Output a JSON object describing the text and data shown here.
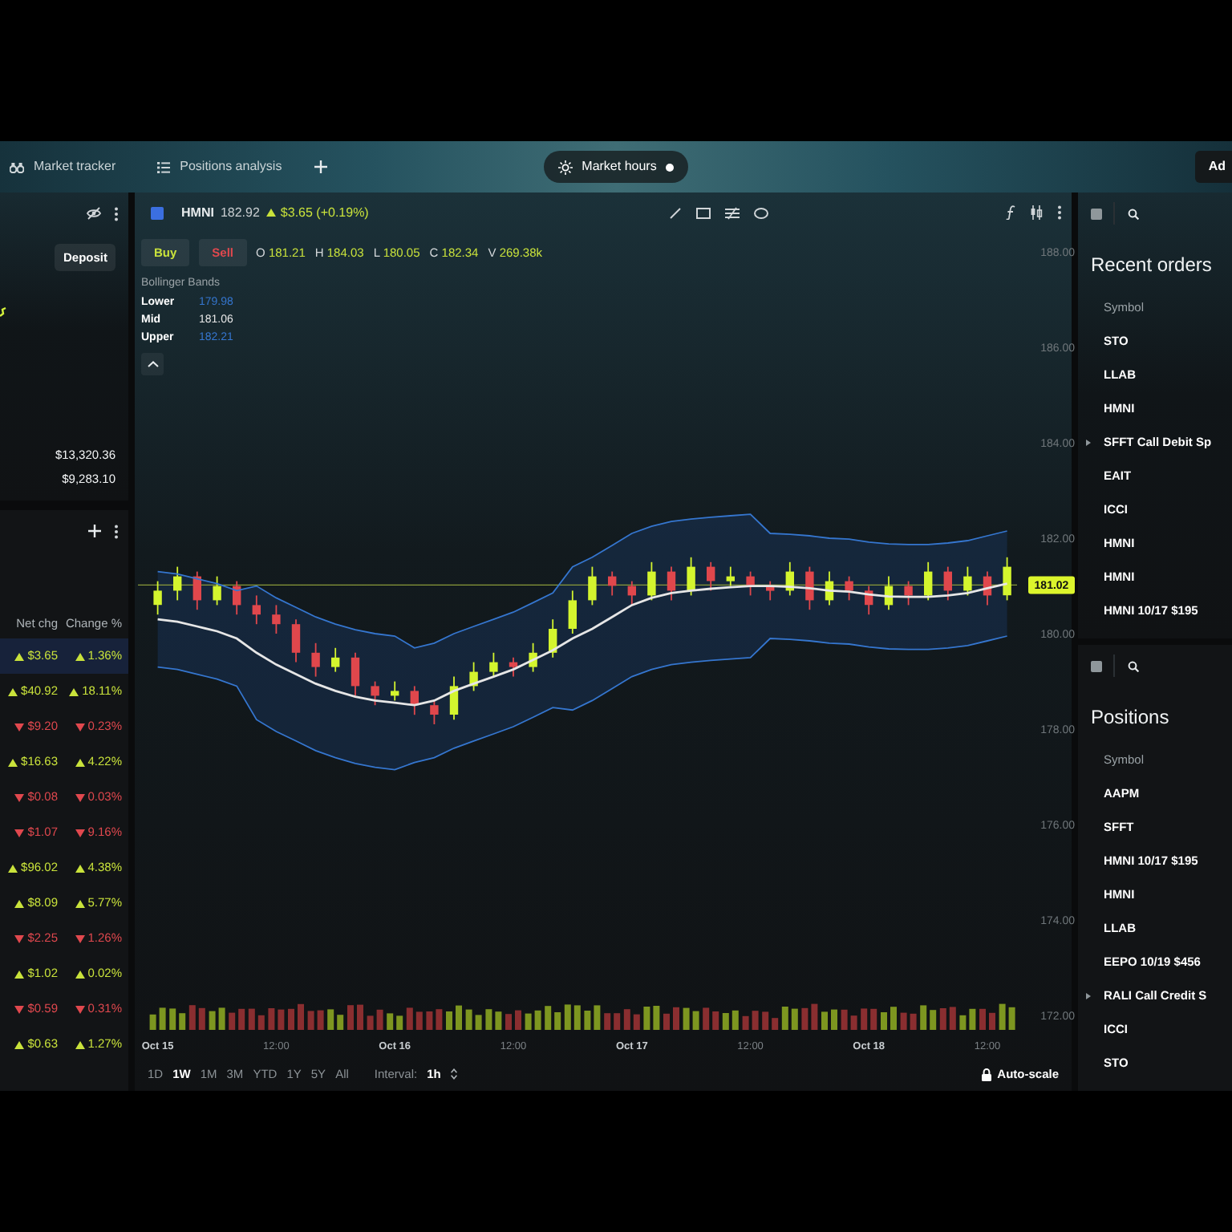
{
  "top_bar": {
    "tabs": [
      {
        "label": "Market tracker",
        "selected": false
      },
      {
        "label": "Positions analysis",
        "selected": false
      }
    ],
    "market_hours": {
      "label": "Market hours",
      "open": true
    },
    "right_button": "Ad"
  },
  "account_panel": {
    "deposit": "Deposit",
    "values": [
      "$13,320.36",
      "$9,283.10"
    ]
  },
  "watchlist": {
    "columns": [
      "Net chg",
      "Change %"
    ],
    "rows": [
      {
        "net_chg": "$3.65",
        "change_pct": "1.36%",
        "rising": true,
        "selected": true
      },
      {
        "net_chg": "$40.92",
        "change_pct": "18.11%",
        "rising": true,
        "selected": false
      },
      {
        "net_chg": "$9.20",
        "change_pct": "0.23%",
        "rising": false,
        "selected": false
      },
      {
        "net_chg": "$16.63",
        "change_pct": "4.22%",
        "rising": true,
        "selected": false
      },
      {
        "net_chg": "$0.08",
        "change_pct": "0.03%",
        "rising": false,
        "selected": false
      },
      {
        "net_chg": "$1.07",
        "change_pct": "9.16%",
        "rising": false,
        "selected": false
      },
      {
        "net_chg": "$96.02",
        "change_pct": "4.38%",
        "rising": true,
        "selected": false
      },
      {
        "net_chg": "$8.09",
        "change_pct": "5.77%",
        "rising": true,
        "selected": false
      },
      {
        "net_chg": "$2.25",
        "change_pct": "1.26%",
        "rising": false,
        "selected": false
      },
      {
        "net_chg": "$1.02",
        "change_pct": "0.02%",
        "rising": true,
        "selected": false
      },
      {
        "net_chg": "$0.59",
        "change_pct": "0.31%",
        "rising": false,
        "selected": false
      },
      {
        "net_chg": "$0.63",
        "change_pct": "1.27%",
        "rising": true,
        "selected": false
      }
    ]
  },
  "chart_header": {
    "symbol": "HMNI",
    "price": "182.92",
    "change": "$3.65 (+0.19%)",
    "rising": true
  },
  "order_buttons": {
    "buy": "Buy",
    "sell": "Sell"
  },
  "ohlcv": [
    {
      "label": "O",
      "value": "181.21"
    },
    {
      "label": "H",
      "value": "184.03"
    },
    {
      "label": "L",
      "value": "180.05"
    },
    {
      "label": "C",
      "value": "182.34"
    },
    {
      "label": "V",
      "value": "269.38k"
    }
  ],
  "indicator": {
    "name": "Bollinger Bands",
    "values": [
      "179.98",
      "181.06",
      "182.21"
    ]
  },
  "chart_data": {
    "type": "candlestick",
    "categories": [
      "Oct 15",
      null,
      null,
      null,
      null,
      null,
      "12:00",
      null,
      null,
      null,
      null,
      null,
      "Oct 16",
      null,
      null,
      null,
      null,
      null,
      "12:00",
      null,
      null,
      null,
      null,
      null,
      "Oct 17",
      null,
      null,
      null,
      null,
      null,
      "12:00",
      null,
      null,
      null,
      null,
      null,
      "Oct 18",
      null,
      null,
      null,
      null,
      null,
      "12:00",
      null
    ],
    "ohlc": [
      [
        180.6,
        181.1,
        180.4,
        180.9
      ],
      [
        180.9,
        181.4,
        180.7,
        181.2
      ],
      [
        181.2,
        181.3,
        180.5,
        180.7
      ],
      [
        180.7,
        181.2,
        180.6,
        181.0
      ],
      [
        181.0,
        181.1,
        180.4,
        180.6
      ],
      [
        180.6,
        180.8,
        180.2,
        180.4
      ],
      [
        180.4,
        180.6,
        180.0,
        180.2
      ],
      [
        180.2,
        180.3,
        179.4,
        179.6
      ],
      [
        179.6,
        179.8,
        179.1,
        179.3
      ],
      [
        179.3,
        179.7,
        179.2,
        179.5
      ],
      [
        179.5,
        179.6,
        178.7,
        178.9
      ],
      [
        178.9,
        179.0,
        178.5,
        178.7
      ],
      [
        178.7,
        179.0,
        178.6,
        178.8
      ],
      [
        178.8,
        178.9,
        178.3,
        178.5
      ],
      [
        178.5,
        178.6,
        178.1,
        178.3
      ],
      [
        178.3,
        179.1,
        178.2,
        178.9
      ],
      [
        178.9,
        179.4,
        178.8,
        179.2
      ],
      [
        179.2,
        179.6,
        179.1,
        179.4
      ],
      [
        179.4,
        179.5,
        179.1,
        179.3
      ],
      [
        179.3,
        179.8,
        179.2,
        179.6
      ],
      [
        179.6,
        180.3,
        179.5,
        180.1
      ],
      [
        180.1,
        180.9,
        180.0,
        180.7
      ],
      [
        180.7,
        181.4,
        180.6,
        181.2
      ],
      [
        181.2,
        181.3,
        180.8,
        181.0
      ],
      [
        181.0,
        181.1,
        180.6,
        180.8
      ],
      [
        180.8,
        181.5,
        180.7,
        181.3
      ],
      [
        181.3,
        181.4,
        180.7,
        180.9
      ],
      [
        180.9,
        181.6,
        180.8,
        181.4
      ],
      [
        181.4,
        181.5,
        180.9,
        181.1
      ],
      [
        181.1,
        181.4,
        181.0,
        181.2
      ],
      [
        181.2,
        181.3,
        180.8,
        181.0
      ],
      [
        181.0,
        181.1,
        180.7,
        180.9
      ],
      [
        180.9,
        181.5,
        180.8,
        181.3
      ],
      [
        181.3,
        181.4,
        180.5,
        180.7
      ],
      [
        180.7,
        181.3,
        180.6,
        181.1
      ],
      [
        181.1,
        181.2,
        180.7,
        180.9
      ],
      [
        180.9,
        181.0,
        180.4,
        180.6
      ],
      [
        180.6,
        181.2,
        180.5,
        181.0
      ],
      [
        181.0,
        181.1,
        180.6,
        180.8
      ],
      [
        180.8,
        181.5,
        180.7,
        181.3
      ],
      [
        181.3,
        181.4,
        180.7,
        180.9
      ],
      [
        180.9,
        181.4,
        180.8,
        181.2
      ],
      [
        181.2,
        181.3,
        180.6,
        180.8
      ],
      [
        180.8,
        181.6,
        180.7,
        181.4
      ]
    ],
    "series": [
      {
        "name": "Lower",
        "type": "line",
        "color": "#3576cf",
        "values": [
          179.3,
          179.25,
          179.15,
          179.05,
          178.9,
          178.2,
          177.95,
          177.75,
          177.55,
          177.4,
          177.28,
          177.2,
          177.15,
          177.3,
          177.4,
          177.6,
          177.75,
          177.9,
          178.05,
          178.25,
          178.45,
          178.4,
          178.6,
          178.85,
          179.1,
          179.25,
          179.35,
          179.4,
          179.44,
          179.47,
          179.5,
          179.9,
          179.88,
          179.85,
          179.8,
          179.78,
          179.72,
          179.68,
          179.67,
          179.67,
          179.7,
          179.75,
          179.85,
          179.95
        ]
      },
      {
        "name": "Mid",
        "type": "line",
        "color": "#e6e6e6",
        "values": [
          180.3,
          180.25,
          180.15,
          180.05,
          179.9,
          179.6,
          179.35,
          179.15,
          178.95,
          178.8,
          178.68,
          178.6,
          178.55,
          178.5,
          178.6,
          178.8,
          178.95,
          179.1,
          179.25,
          179.45,
          179.65,
          179.9,
          180.1,
          180.35,
          180.6,
          180.75,
          180.85,
          180.9,
          180.94,
          180.97,
          181.0,
          181.0,
          180.98,
          180.95,
          180.9,
          180.88,
          180.82,
          180.78,
          180.77,
          180.77,
          180.8,
          180.85,
          180.95,
          181.05
        ]
      },
      {
        "name": "Upper",
        "type": "line",
        "color": "#3576cf",
        "values": [
          181.3,
          181.25,
          181.15,
          181.05,
          180.9,
          181.0,
          180.75,
          180.55,
          180.35,
          180.2,
          180.08,
          180.0,
          179.95,
          179.7,
          179.8,
          180.0,
          180.15,
          180.3,
          180.45,
          180.65,
          180.85,
          181.4,
          181.6,
          181.85,
          182.1,
          182.25,
          182.35,
          182.4,
          182.44,
          182.47,
          182.5,
          182.1,
          182.08,
          182.05,
          182.0,
          181.98,
          181.92,
          181.88,
          181.87,
          181.87,
          181.9,
          181.95,
          182.05,
          182.15
        ]
      }
    ],
    "ref_lines": [
      {
        "axis": "y",
        "value": 181.02,
        "label": "181.02"
      }
    ],
    "ylim": [
      172,
      188
    ],
    "yticks": [
      {
        "value": 172,
        "label": "172.00"
      },
      {
        "value": 174,
        "label": "174.00"
      },
      {
        "value": 176,
        "label": "176.00"
      },
      {
        "value": 178,
        "label": "178.00"
      },
      {
        "value": 180,
        "label": "180.00"
      },
      {
        "value": 182,
        "label": "182.00"
      },
      {
        "value": 184,
        "label": "184.00"
      },
      {
        "value": 186,
        "label": "186.00"
      },
      {
        "value": 188,
        "label": "188.00"
      }
    ]
  },
  "ranges": [
    {
      "label": "1D",
      "selected": false
    },
    {
      "label": "1W",
      "selected": true
    },
    {
      "label": "1M",
      "selected": false
    },
    {
      "label": "3M",
      "selected": false
    },
    {
      "label": "YTD",
      "selected": false
    },
    {
      "label": "1Y",
      "selected": false
    },
    {
      "label": "5Y",
      "selected": false
    },
    {
      "label": "All",
      "selected": false
    }
  ],
  "interval": {
    "label": "Interval:",
    "value": "1h"
  },
  "autoscale": {
    "label": "Auto-scale",
    "locked": true
  },
  "recent_orders": {
    "title": "Recent orders",
    "column": "Symbol",
    "rows": [
      {
        "symbol": "STO",
        "expandable": false
      },
      {
        "symbol": "LLAB",
        "expandable": false
      },
      {
        "symbol": "HMNI",
        "expandable": false
      },
      {
        "symbol": "SFFT Call Debit Sp",
        "expandable": true
      },
      {
        "symbol": "EAIT",
        "expandable": false
      },
      {
        "symbol": "ICCI",
        "expandable": false
      },
      {
        "symbol": "HMNI",
        "expandable": false
      },
      {
        "symbol": "HMNI",
        "expandable": false
      },
      {
        "symbol": "HMNI 10/17 $195",
        "expandable": false
      }
    ]
  },
  "positions": {
    "title": "Positions",
    "column": "Symbol",
    "rows": [
      {
        "symbol": "AAPM",
        "expandable": false
      },
      {
        "symbol": "SFFT",
        "expandable": false
      },
      {
        "symbol": "HMNI 10/17 $195",
        "expandable": false
      },
      {
        "symbol": "HMNI",
        "expandable": false
      },
      {
        "symbol": "LLAB",
        "expandable": false
      },
      {
        "symbol": "EEPO 10/19 $456",
        "expandable": false
      },
      {
        "symbol": "RALI Call Credit S",
        "expandable": true
      },
      {
        "symbol": "ICCI",
        "expandable": false
      },
      {
        "symbol": "STO",
        "expandable": false
      }
    ]
  }
}
